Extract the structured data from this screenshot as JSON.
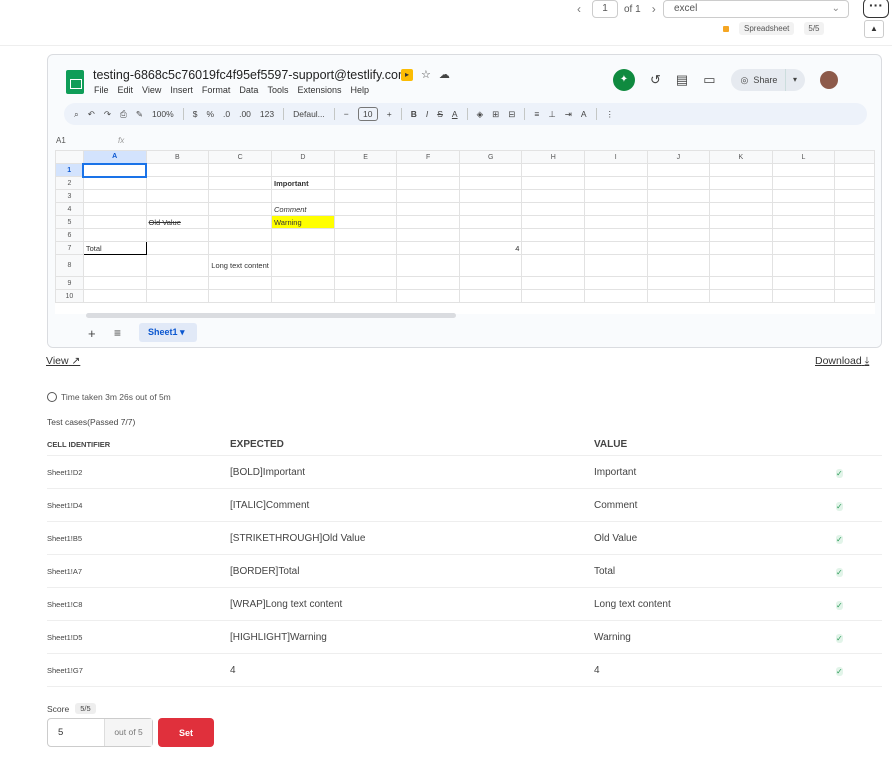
{
  "pager": {
    "current": "1",
    "total_label": "of 1"
  },
  "file_type_select": {
    "value": "excel"
  },
  "meta": {
    "type_tag": "Spreadsheet",
    "score_badge": "5/5"
  },
  "sheet": {
    "title": "testing-6868c5c76019fc4f95ef5597-support@testlify.com",
    "menus": [
      "File",
      "Edit",
      "View",
      "Insert",
      "Format",
      "Data",
      "Tools",
      "Extensions",
      "Help"
    ],
    "share_label": "Share",
    "toolbar": {
      "zoom": "100%",
      "currency": "$",
      "percent": "%",
      "dec_less": ".0",
      "dec_more": ".00",
      "num_format": "123",
      "font": "Defaul...",
      "font_size": "10",
      "bold": "B",
      "italic": "I",
      "strike": "S",
      "textcolor": "A"
    },
    "cell_ref": "A1",
    "fx": "fx",
    "columns": [
      "A",
      "B",
      "C",
      "D",
      "E",
      "F",
      "G",
      "H",
      "I",
      "J",
      "K",
      "L"
    ],
    "rows": [
      "1",
      "2",
      "3",
      "4",
      "5",
      "6",
      "7",
      "8",
      "9",
      "10"
    ],
    "cells": {
      "D2": "Important",
      "D4": "Comment",
      "B5": "Old Value",
      "D5": "Warning",
      "A7": "Total",
      "G7": "4",
      "C8": "Long text content"
    },
    "tab_name": "Sheet1"
  },
  "links": {
    "view": "View",
    "download": "Download"
  },
  "time_taken": "Time taken 3m 26s out of 5m",
  "test_cases_title": "Test cases(Passed 7/7)",
  "table_headers": {
    "id": "CELL IDENTIFIER",
    "expected": "EXPECTED",
    "value": "VALUE"
  },
  "test_cases": [
    {
      "id": "Sheet1!D2",
      "expected": "[BOLD]Important",
      "value": "Important"
    },
    {
      "id": "Sheet1!D4",
      "expected": "[ITALIC]Comment",
      "value": "Comment"
    },
    {
      "id": "Sheet1!B5",
      "expected": "[STRIKETHROUGH]Old Value",
      "value": "Old Value"
    },
    {
      "id": "Sheet1!A7",
      "expected": "[BORDER]Total",
      "value": "Total"
    },
    {
      "id": "Sheet1!C8",
      "expected": "[WRAP]Long text content",
      "value": "Long text content"
    },
    {
      "id": "Sheet1!D5",
      "expected": "[HIGHLIGHT]Warning",
      "value": "Warning"
    },
    {
      "id": "Sheet1!G7",
      "expected": "4",
      "value": "4"
    }
  ],
  "score": {
    "label": "Score",
    "badge": "5/5",
    "value": "5",
    "suffix": "out of 5",
    "set_label": "Set"
  },
  "colors": {
    "accent": "#e0303c",
    "sheets_green": "#0f9d58",
    "highlight": "#ffff00",
    "pass": "#2e9b5a"
  }
}
